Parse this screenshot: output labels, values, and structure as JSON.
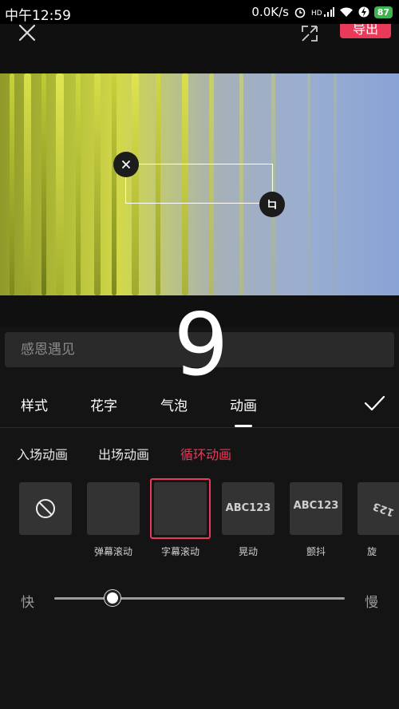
{
  "status_bar": {
    "time": "中午12:59",
    "speed": "0.0K/s",
    "network": "HD",
    "battery": "87"
  },
  "top_bar": {
    "export_label": "导出"
  },
  "text_input": {
    "value": "感恩遇见"
  },
  "overlay": {
    "digit": "9"
  },
  "tabs": [
    {
      "label": "样式"
    },
    {
      "label": "花字"
    },
    {
      "label": "气泡"
    },
    {
      "label": "动画",
      "active": true
    }
  ],
  "sub_tabs": [
    {
      "label": "入场动画"
    },
    {
      "label": "出场动画"
    },
    {
      "label": "循环动画",
      "active": true
    }
  ],
  "animations": [
    {
      "label": "",
      "icon": "none-icon"
    },
    {
      "label": "弹幕滚动"
    },
    {
      "label": "字幕滚动",
      "selected": true
    },
    {
      "label": "晃动",
      "preview": "ABC123"
    },
    {
      "label": "颤抖",
      "preview": "ABC123"
    },
    {
      "label": "旋",
      "preview": "123"
    }
  ],
  "speed": {
    "slow_label": "快",
    "fast_label": "慢",
    "value": 0.2
  },
  "colors": {
    "accent": "#ea3a5a",
    "battery": "#3fb34f"
  }
}
